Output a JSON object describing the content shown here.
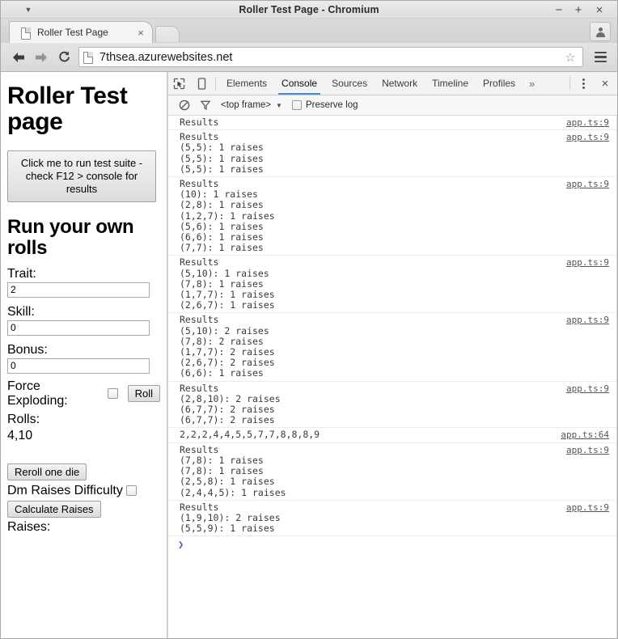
{
  "window": {
    "title": "Roller Test Page - Chromium",
    "menu_caret_icon": "caret-down-icon",
    "minimize_label": "−",
    "maximize_label": "+",
    "close_label": "×"
  },
  "tabstrip": {
    "tab_title": "Roller Test Page",
    "tab_favicon_icon": "page-icon",
    "tab_close_label": "×",
    "new_tab_icon": "new-tab-icon",
    "profile_icon": "person-icon"
  },
  "navbar": {
    "back_icon": "arrow-left-icon",
    "forward_icon": "arrow-right-icon",
    "reload_icon": "reload-icon",
    "omnibox_icon": "page-icon",
    "url": "7thsea.azurewebsites.net",
    "star_label": "☆",
    "menu_icon": "hamburger-menu-icon"
  },
  "page": {
    "heading": "Roller Test page",
    "run_suite_button": "Click me to run test suite - check F12 > console for results",
    "subheading": "Run your own rolls",
    "trait_label": "Trait:",
    "trait_value": "2",
    "skill_label": "Skill:",
    "skill_value": "0",
    "bonus_label": "Bonus:",
    "bonus_value": "0",
    "force_exploding_label": "Force Exploding:",
    "roll_button": "Roll",
    "rolls_label": "Rolls:",
    "rolls_value": "4,10",
    "reroll_button": "Reroll one die",
    "dm_raises_label": "Dm Raises Difficulty",
    "calculate_button": "Calculate Raises",
    "raises_label": "Raises:"
  },
  "devtools": {
    "inspect_icon": "inspect-cursor-icon",
    "device_icon": "device-toolbar-icon",
    "tabs": [
      {
        "label": "Elements",
        "active": false
      },
      {
        "label": "Console",
        "active": true
      },
      {
        "label": "Sources",
        "active": false
      },
      {
        "label": "Network",
        "active": false
      },
      {
        "label": "Timeline",
        "active": false
      },
      {
        "label": "Profiles",
        "active": false
      }
    ],
    "more_tabs_label": "»",
    "kebab_icon": "more-options-icon",
    "close_label": "×",
    "filterbar": {
      "clear_icon": "clear-console-icon",
      "filter_icon": "filter-funnel-icon",
      "frame_value": "<top frame>",
      "frame_caret": "▼",
      "preserve_log_label": "Preserve log"
    },
    "console_messages": [
      {
        "lines": [
          "Results"
        ],
        "source": "app.ts:9"
      },
      {
        "lines": [
          "Results",
          "(5,5): 1 raises",
          "(5,5): 1 raises",
          "(5,5): 1 raises"
        ],
        "source": "app.ts:9"
      },
      {
        "lines": [
          "Results",
          "(10): 1 raises",
          "(2,8): 1 raises",
          "(1,2,7): 1 raises",
          "(5,6): 1 raises",
          "(6,6): 1 raises",
          "(7,7): 1 raises"
        ],
        "source": "app.ts:9"
      },
      {
        "lines": [
          "Results",
          "(5,10): 1 raises",
          "(7,8): 1 raises",
          "(1,7,7): 1 raises",
          "(2,6,7): 1 raises"
        ],
        "source": "app.ts:9"
      },
      {
        "lines": [
          "Results",
          "(5,10): 2 raises",
          "(7,8): 2 raises",
          "(1,7,7): 2 raises",
          "(2,6,7): 2 raises",
          "(6,6): 1 raises"
        ],
        "source": "app.ts:9"
      },
      {
        "lines": [
          "Results",
          "(2,8,10): 2 raises",
          "(6,7,7): 2 raises",
          "(6,7,7): 2 raises"
        ],
        "source": "app.ts:9"
      },
      {
        "lines": [
          "2,2,2,4,4,5,5,7,7,8,8,8,9"
        ],
        "source": "app.ts:64"
      },
      {
        "lines": [
          "Results",
          "(7,8): 1 raises",
          "(7,8): 1 raises",
          "(2,5,8): 1 raises",
          "(2,4,4,5): 1 raises"
        ],
        "source": "app.ts:9"
      },
      {
        "lines": [
          "Results",
          "(1,9,10): 2 raises",
          "(5,5,9): 1 raises"
        ],
        "source": "app.ts:9"
      }
    ],
    "prompt_symbol": "❯"
  },
  "colors": {
    "accent": "#3b8ee0",
    "prompt": "#2f66c8",
    "chrome_bg": "#dededc",
    "page_bg": "#ffffff"
  }
}
